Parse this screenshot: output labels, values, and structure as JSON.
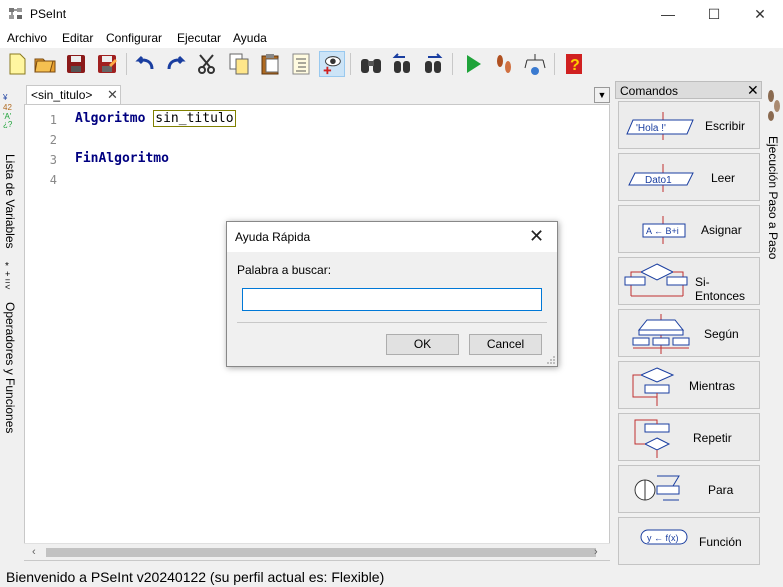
{
  "window": {
    "title": "PSeInt",
    "minimize": "—",
    "maximize": "☐",
    "close": "✕"
  },
  "menu": [
    "Archivo",
    "Editar",
    "Configurar",
    "Ejecutar",
    "Ayuda"
  ],
  "left_tabs": {
    "variables": "Lista de Variables",
    "operators": "Operadores y Funciones"
  },
  "editor": {
    "tab_label": "<sin_titulo>",
    "tab_close": "✕",
    "lines": [
      {
        "num": "1",
        "keyword": "Algoritmo",
        "ident": "sin_titulo"
      },
      {
        "num": "2"
      },
      {
        "num": "3",
        "keyword": "FinAlgoritmo"
      },
      {
        "num": "4"
      }
    ]
  },
  "commands": {
    "title": "Comandos",
    "close": "✕",
    "items": [
      {
        "label": "Escribir",
        "icon_text": "'Hola !'"
      },
      {
        "label": "Leer",
        "icon_text": "Dato1"
      },
      {
        "label": "Asignar",
        "icon_text": "A ← B+i"
      },
      {
        "label": "Si-Entonces",
        "icon_text": ""
      },
      {
        "label": "Según",
        "icon_text": ""
      },
      {
        "label": "Mientras",
        "icon_text": ""
      },
      {
        "label": "Repetir",
        "icon_text": ""
      },
      {
        "label": "Para",
        "icon_text": ""
      },
      {
        "label": "Función",
        "icon_text": "y ← f(x)"
      }
    ]
  },
  "right_tab": {
    "label": "Ejecución Paso a Paso"
  },
  "status": {
    "text": "Bienvenido a PSeInt v20240122 (su perfil actual es: Flexible)"
  },
  "dialog": {
    "title": "Ayuda Rápida",
    "close": "✕",
    "prompt": "Palabra a buscar:",
    "input_value": "",
    "ok": "OK",
    "cancel": "Cancel"
  },
  "colors": {
    "keyword": "#000080",
    "accent": "#0078d7",
    "run_green": "#1fa33a"
  }
}
